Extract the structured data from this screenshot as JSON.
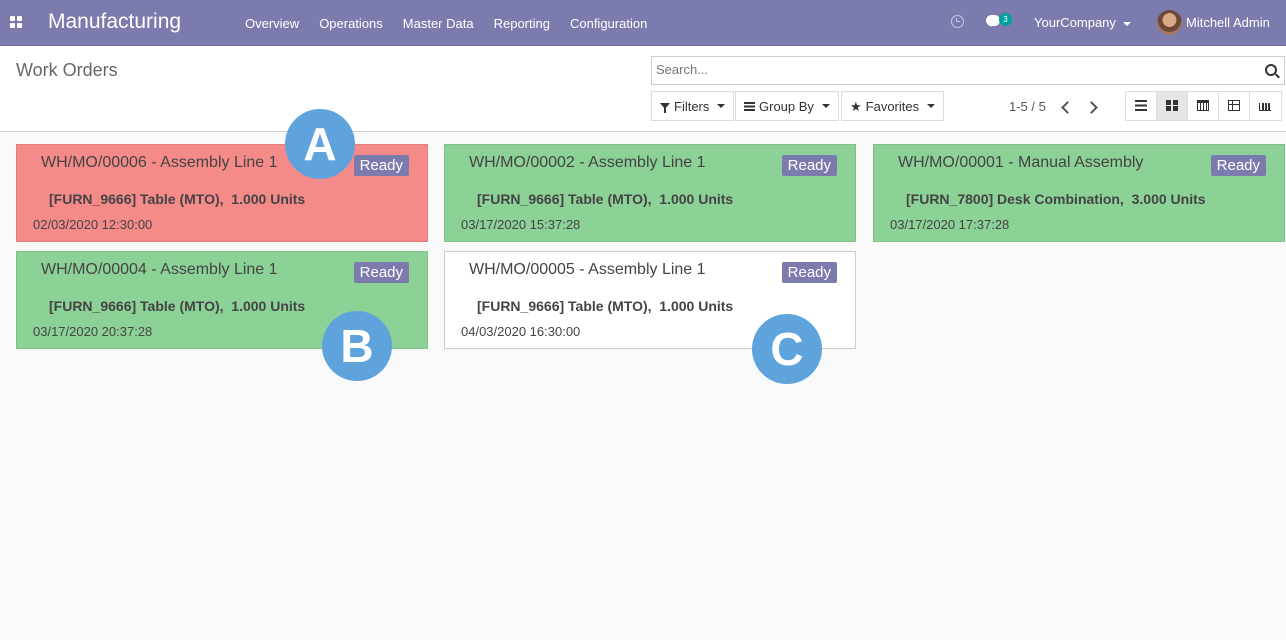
{
  "app": {
    "brand": "Manufacturing",
    "menu": [
      "Overview",
      "Operations",
      "Master Data",
      "Reporting",
      "Configuration"
    ]
  },
  "systray": {
    "messages_count": "3",
    "company": "YourCompany",
    "user": "Mitchell Admin"
  },
  "control_panel": {
    "title": "Work Orders",
    "search_placeholder": "Search...",
    "filters_label": "Filters",
    "groupby_label": "Group By",
    "favorites_label": "Favorites",
    "pager": "1-5 / 5",
    "active_view": "kanban"
  },
  "cards": [
    {
      "title": "WH/MO/00006 - Assembly Line 1",
      "status": "Ready",
      "product": "[FURN_9666] Table (MTO),",
      "qty": "1.000 Units",
      "date": "02/03/2020 12:30:00",
      "color": "#f48b88"
    },
    {
      "title": "WH/MO/00002 - Assembly Line 1",
      "status": "Ready",
      "product": "[FURN_9666] Table (MTO),",
      "qty": "1.000 Units",
      "date": "03/17/2020 15:37:28",
      "color": "#8cd196"
    },
    {
      "title": "WH/MO/00001 - Manual Assembly",
      "status": "Ready",
      "product": "[FURN_7800] Desk Combination,",
      "qty": "3.000 Units",
      "date": "03/17/2020 17:37:28",
      "color": "#8cd196"
    },
    {
      "title": "WH/MO/00004 - Assembly Line 1",
      "status": "Ready",
      "product": "[FURN_9666] Table (MTO),",
      "qty": "1.000 Units",
      "date": "03/17/2020 20:37:28",
      "color": "#8cd196"
    },
    {
      "title": "WH/MO/00005 - Assembly Line 1",
      "status": "Ready",
      "product": "[FURN_9666] Table (MTO),",
      "qty": "1.000 Units",
      "date": "04/03/2020 16:30:00",
      "color": "#ffffff"
    }
  ],
  "markers": [
    "A",
    "B",
    "C"
  ],
  "colors": {
    "navbar": "#7c7bad",
    "badge": "#7c7bad",
    "marker": "#5fa3dc"
  }
}
